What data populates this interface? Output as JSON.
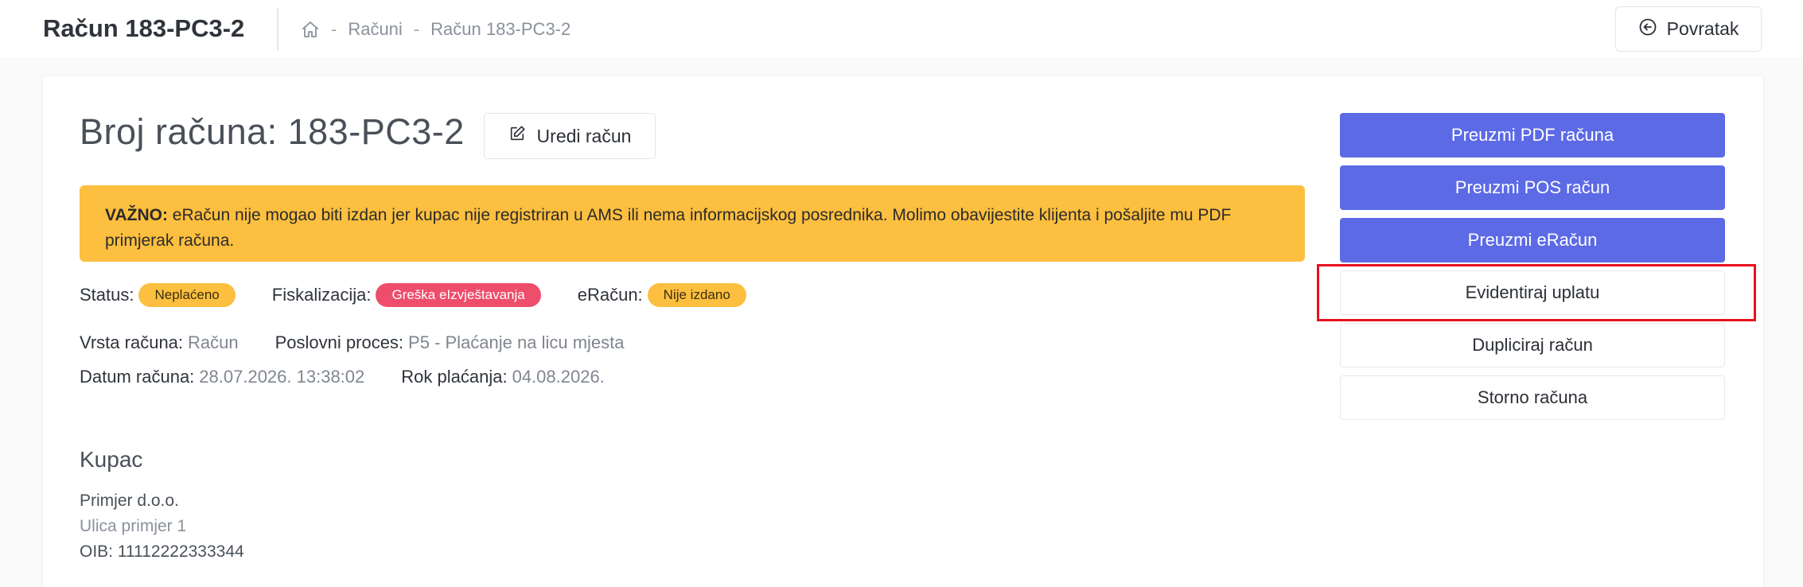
{
  "header": {
    "title": "Račun 183-PC3-2",
    "breadcrumb": [
      "Računi",
      "Račun 183-PC3-2"
    ],
    "breadcrumb_separator": "-",
    "back_label": "Povratak"
  },
  "invoice": {
    "heading": "Broj računa: 183-PC3-2",
    "edit_label": "Uredi račun"
  },
  "alert": {
    "prefix": "VAŽNO:",
    "text": "eRačun nije mogao biti izdan jer kupac nije registriran u AMS ili nema informacijskog posrednika. Molimo obavijestite klijenta i pošaljite mu PDF primjerak računa."
  },
  "status": {
    "status_label": "Status:",
    "status_value": "Neplaćeno",
    "fiscal_label": "Fiskalizacija:",
    "fiscal_value": "Greška eIzvještavanja",
    "eracun_label": "eRačun:",
    "eracun_value": "Nije izdano"
  },
  "meta": {
    "type_label": "Vrsta računa:",
    "type_value": "Račun",
    "process_label": "Poslovni proces:",
    "process_value": "P5 - Plaćanje na licu mjesta",
    "date_label": "Datum računa:",
    "date_value": "28.07.2026. 13:38:02",
    "due_label": "Rok plaćanja:",
    "due_value": "04.08.2026."
  },
  "buyer": {
    "heading": "Kupac",
    "name": "Primjer d.o.o.",
    "address": "Ulica primjer 1",
    "oib": "OIB: 11112222333344"
  },
  "actions": {
    "download_pdf": "Preuzmi PDF računa",
    "download_pos": "Preuzmi POS račun",
    "download_eracun": "Preuzmi eRačun",
    "record_payment": "Evidentiraj uplatu",
    "duplicate": "Dupliciraj račun",
    "storno": "Storno računa"
  },
  "colors": {
    "primary": "#5c6ae6",
    "warning": "#fdbf3f",
    "danger": "#ee4d6b",
    "highlight": "#e8101c"
  }
}
